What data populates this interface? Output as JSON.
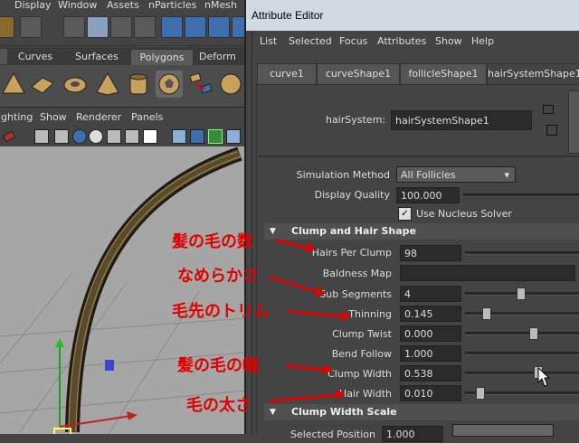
{
  "main_window": {
    "menu": [
      "Display",
      "Window",
      "Assets",
      "nParticles",
      "nMesh"
    ],
    "shelf_tabs": [
      "Curves",
      "Surfaces",
      "Polygons",
      "Deform"
    ],
    "panel_menu": [
      "ighting",
      "Show",
      "Renderer",
      "Panels"
    ]
  },
  "attribute_editor": {
    "title": "Attribute Editor",
    "menu": [
      "List",
      "Selected",
      "Focus",
      "Attributes",
      "Show",
      "Help"
    ],
    "tabs": [
      "curve1",
      "curveShape1",
      "follicleShape1",
      "hairSystemShape1"
    ],
    "node_label": "hairSystem:",
    "node_value": "hairSystemShape1",
    "sim_method_label": "Simulation Method",
    "sim_method_value": "All Follicles",
    "display_quality_label": "Display Quality",
    "display_quality_value": "100.000",
    "nucleus_label": "Use Nucleus Solver",
    "section_clump": "Clump and Hair Shape",
    "fields": {
      "hairs_per_clump": {
        "label": "Hairs Per Clump",
        "value": "98"
      },
      "baldness_map": {
        "label": "Baldness Map"
      },
      "sub_segments": {
        "label": "Sub Segments",
        "value": "4"
      },
      "thinning": {
        "label": "Thinning",
        "value": "0.145"
      },
      "clump_twist": {
        "label": "Clump Twist",
        "value": "0.000"
      },
      "bend_follow": {
        "label": "Bend Follow",
        "value": "1.000"
      },
      "clump_width": {
        "label": "Clump Width",
        "value": "0.538"
      },
      "hair_width": {
        "label": "Hair Width",
        "value": "0.010"
      }
    },
    "section_clump_width": "Clump Width Scale",
    "selected_position_label": "Selected Position",
    "selected_position_value": "1.000"
  },
  "annotations": {
    "hairs_per_clump": "髪の毛の数",
    "sub_segments": "なめらかさ",
    "thinning": "毛先のトリム",
    "clump_width": "髪の毛の幅",
    "hair_width": "毛の太さ"
  },
  "colors": {
    "annotation": "#e00000",
    "title_bar": "#cfd8e3",
    "panel_bg": "#444444",
    "viewport_bg": "#a6a6a6"
  }
}
